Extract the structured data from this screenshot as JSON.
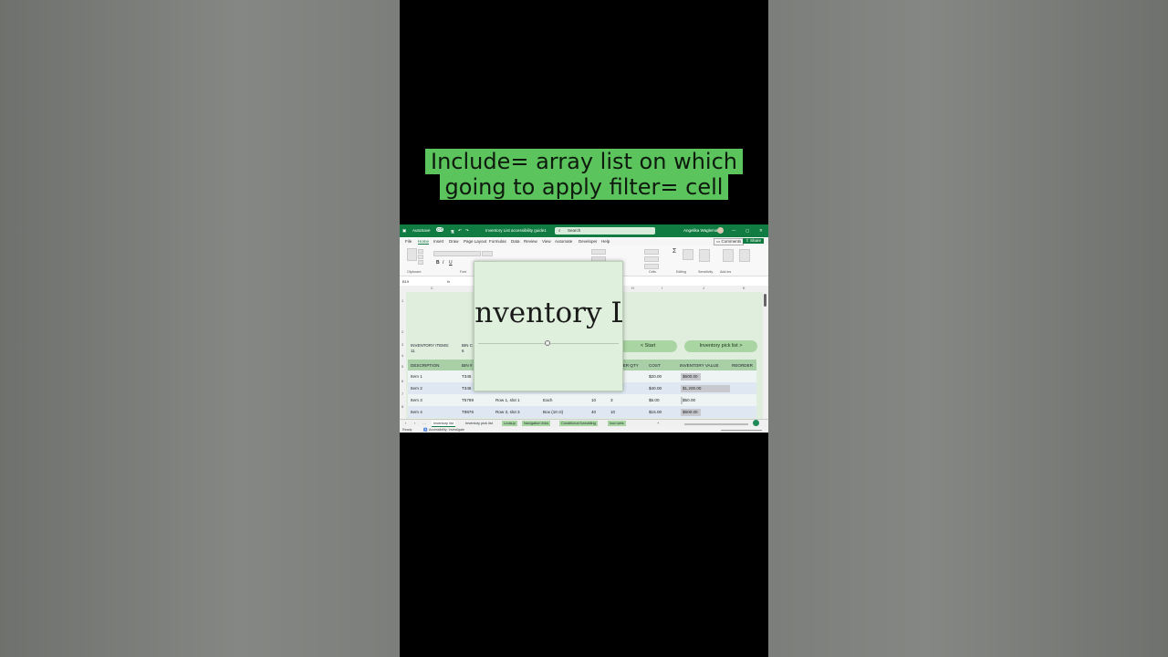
{
  "caption": {
    "line1": "Include= array list on which",
    "line2": "going to apply filter= cell"
  },
  "window": {
    "autosave": "AutoSave",
    "autosave_state": "Off",
    "filename": "Inventory List accessibility guide1",
    "search_placeholder": "Search",
    "user": "Angelika Wagleman"
  },
  "menu": [
    "File",
    "Home",
    "Insert",
    "Draw",
    "Page Layout",
    "Formulas",
    "Data",
    "Review",
    "View",
    "Automate",
    "Developer",
    "Help"
  ],
  "menu_active": "Home",
  "ribbon": {
    "comments": "Comments",
    "share": "Share",
    "groups": [
      "Clipboard",
      "Font",
      "Cells",
      "Editing",
      "Sensitivity",
      "Add-ins"
    ]
  },
  "formula": {
    "namebox": "B19",
    "fx": "fx"
  },
  "columns": [
    "C",
    "D",
    "E",
    "F",
    "G",
    "H",
    "I",
    "J",
    "K"
  ],
  "rows": [
    "1",
    "2",
    "3",
    "4",
    "5",
    "6",
    "7",
    "8"
  ],
  "sheet": {
    "title_overlay": "Inventory Li",
    "inventory_items_label": "INVENTORY ITEMS:",
    "inventory_items_value": "11",
    "bin_label": "BIN C",
    "bin_value": "6",
    "start_button": "< Start",
    "pick_list_button": "Inventory pick list >",
    "headers": [
      "DESCRIPTION",
      "BIN #",
      "",
      "",
      "RDER QTY",
      "COST",
      "INVENTORY VALUE",
      "REORDER"
    ],
    "rows": [
      {
        "desc": "Item 1",
        "bin": "T345",
        "loc": "",
        "unit": "",
        "qty": "",
        "reorder_qty": "",
        "cost": "$20.00",
        "value": "$600.00",
        "fill": 0.4
      },
      {
        "desc": "Item 2",
        "bin": "T345",
        "loc": "Row 2, slot 1",
        "unit": "Each",
        "qty": "30",
        "reorder_qty": "15",
        "cost": "$40.00",
        "value": "$1,200.00",
        "fill": 1.0
      },
      {
        "desc": "Item 3",
        "bin": "T5789",
        "loc": "Row 1, slot 1",
        "unit": "Each",
        "qty": "10",
        "reorder_qty": "3",
        "cost": "$5.00",
        "value": "$50.00",
        "fill": 0.04
      },
      {
        "desc": "Item 4",
        "bin": "T9876",
        "loc": "Row 3, slot 3",
        "unit": "Box (10 ct)",
        "qty": "40",
        "reorder_qty": "10",
        "cost": "$15.00",
        "value": "$600.00",
        "fill": 0.4
      }
    ]
  },
  "tabs": [
    "Inventory list",
    "Inventory pick list",
    "Lookup",
    "Navigation links",
    "Conditional formatting",
    "Icon sets"
  ],
  "tabs_active": "Inventory list",
  "status": {
    "ready": "Ready",
    "accessibility": "Accessibility: Investigate"
  }
}
